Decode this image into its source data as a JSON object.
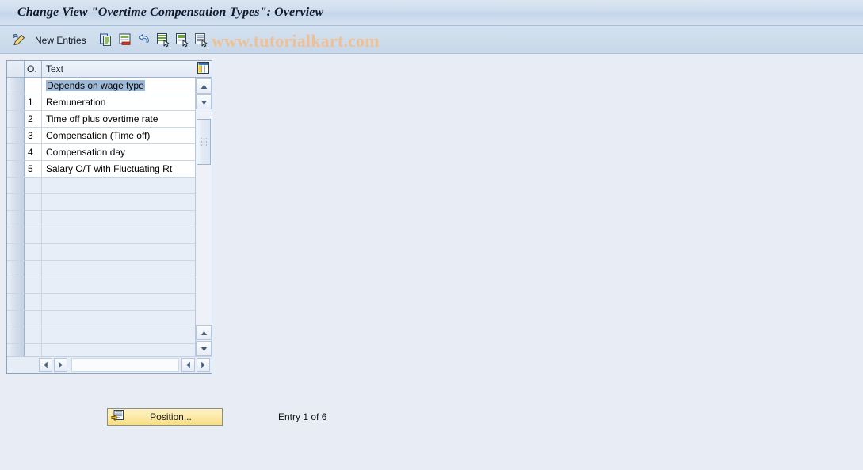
{
  "window": {
    "title": "Change View \"Overtime Compensation Types\": Overview"
  },
  "toolbar": {
    "edit_icon": "pencil-icon",
    "new_entries_label": "New Entries",
    "buttons": [
      {
        "icon": "copy-icon",
        "name": "copy-as-button"
      },
      {
        "icon": "delete-icon",
        "name": "delete-button"
      },
      {
        "icon": "undo-icon",
        "name": "undo-button"
      },
      {
        "icon": "select-all-icon",
        "name": "select-all-button"
      },
      {
        "icon": "deselect-all-icon",
        "name": "deselect-all-button"
      },
      {
        "icon": "details-icon",
        "name": "details-button"
      }
    ]
  },
  "watermark": {
    "text": "www.tutorialkart.com",
    "color": "#eec093"
  },
  "table": {
    "columns": [
      {
        "key": "selector",
        "label": ""
      },
      {
        "key": "code",
        "label": "O."
      },
      {
        "key": "text",
        "label": "Text"
      }
    ],
    "config_icon": "column-config-icon",
    "rows": [
      {
        "code": "",
        "text": "Depends on wage type",
        "selected": true
      },
      {
        "code": "1",
        "text": "Remuneration",
        "selected": false
      },
      {
        "code": "2",
        "text": "Time off plus overtime rate",
        "selected": false
      },
      {
        "code": "3",
        "text": "Compensation (Time off)",
        "selected": false
      },
      {
        "code": "4",
        "text": "Compensation day",
        "selected": false
      },
      {
        "code": "5",
        "text": "Salary O/T with Fluctuating Rt",
        "selected": false
      }
    ],
    "empty_row_count": 11
  },
  "scrollbars": {
    "v_up_icon": "scroll-up-icon",
    "v_down_icon": "scroll-down-icon",
    "v_page_up_icon": "page-up-icon",
    "v_page_down_icon": "page-down-icon",
    "h_left_icon": "scroll-left-icon",
    "h_right_icon": "scroll-right-icon"
  },
  "footer": {
    "position_button_label": "Position...",
    "position_button_icon": "position-list-icon",
    "entry_status": "Entry 1 of 6"
  },
  "colors": {
    "page_background": "#e8edf5",
    "titlebar": "#cedcee",
    "toolbar": "#cddcec",
    "selection_highlight": "#9db9d8",
    "button_yellow": "#fbe9a4",
    "table_border": "#8aa4c0"
  }
}
